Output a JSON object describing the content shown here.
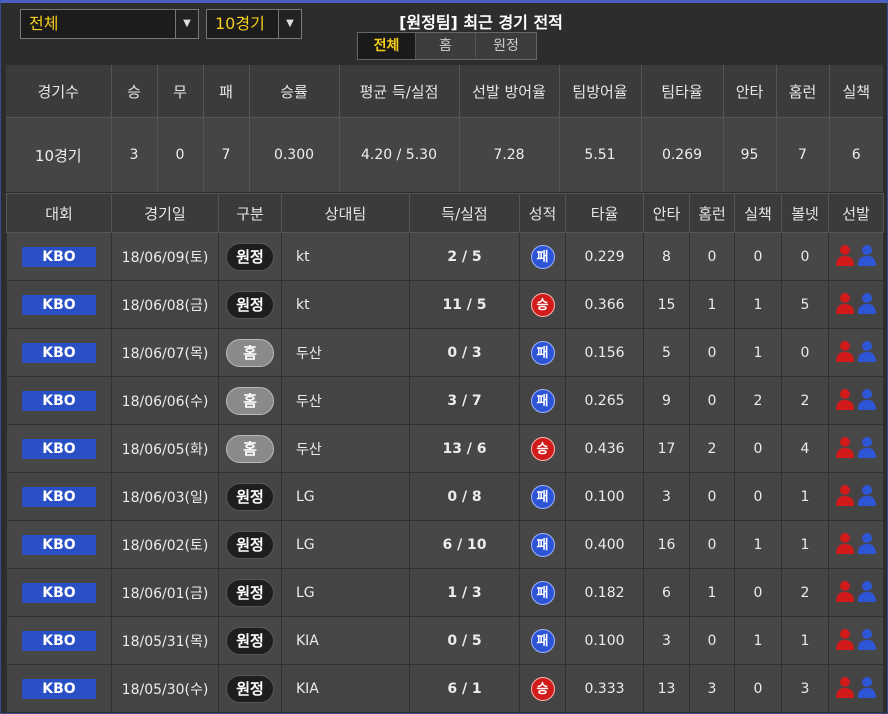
{
  "controls": {
    "filter_value": "전체",
    "games_value": "10경기",
    "title": "[원정팀] 최근 경기 전적",
    "tabs": [
      {
        "label": "전체",
        "active": true
      },
      {
        "label": "홈",
        "active": false
      },
      {
        "label": "원정",
        "active": false
      }
    ]
  },
  "summary": {
    "headers": [
      "경기수",
      "승",
      "무",
      "패",
      "승률",
      "평균 득/실점",
      "선발 방어율",
      "팀방어율",
      "팀타율",
      "안타",
      "홈런",
      "실책"
    ],
    "values": [
      "10경기",
      "3",
      "0",
      "7",
      "0.300",
      "4.20 / 5.30",
      "7.28",
      "5.51",
      "0.269",
      "95",
      "7",
      "6"
    ]
  },
  "games": {
    "headers": [
      "대회",
      "경기일",
      "구분",
      "상대팀",
      "득/실점",
      "성적",
      "타율",
      "안타",
      "홈런",
      "실책",
      "볼넷",
      "선발"
    ],
    "rows": [
      {
        "league": "KBO",
        "date": "18/06/09(토)",
        "side": "원정",
        "opp": "kt",
        "score": "2 / 5",
        "result": "패",
        "avg": "0.229",
        "hits": "8",
        "hr": "0",
        "err": "0",
        "bb": "0"
      },
      {
        "league": "KBO",
        "date": "18/06/08(금)",
        "side": "원정",
        "opp": "kt",
        "score": "11 / 5",
        "result": "승",
        "avg": "0.366",
        "hits": "15",
        "hr": "1",
        "err": "1",
        "bb": "5"
      },
      {
        "league": "KBO",
        "date": "18/06/07(목)",
        "side": "홈",
        "opp": "두산",
        "score": "0 / 3",
        "result": "패",
        "avg": "0.156",
        "hits": "5",
        "hr": "0",
        "err": "1",
        "bb": "0"
      },
      {
        "league": "KBO",
        "date": "18/06/06(수)",
        "side": "홈",
        "opp": "두산",
        "score": "3 / 7",
        "result": "패",
        "avg": "0.265",
        "hits": "9",
        "hr": "0",
        "err": "2",
        "bb": "2"
      },
      {
        "league": "KBO",
        "date": "18/06/05(화)",
        "side": "홈",
        "opp": "두산",
        "score": "13 / 6",
        "result": "승",
        "avg": "0.436",
        "hits": "17",
        "hr": "2",
        "err": "0",
        "bb": "4"
      },
      {
        "league": "KBO",
        "date": "18/06/03(일)",
        "side": "원정",
        "opp": "LG",
        "score": "0 / 8",
        "result": "패",
        "avg": "0.100",
        "hits": "3",
        "hr": "0",
        "err": "0",
        "bb": "1"
      },
      {
        "league": "KBO",
        "date": "18/06/02(토)",
        "side": "원정",
        "opp": "LG",
        "score": "6 / 10",
        "result": "패",
        "avg": "0.400",
        "hits": "16",
        "hr": "0",
        "err": "1",
        "bb": "1"
      },
      {
        "league": "KBO",
        "date": "18/06/01(금)",
        "side": "원정",
        "opp": "LG",
        "score": "1 / 3",
        "result": "패",
        "avg": "0.182",
        "hits": "6",
        "hr": "1",
        "err": "0",
        "bb": "2"
      },
      {
        "league": "KBO",
        "date": "18/05/31(목)",
        "side": "원정",
        "opp": "KIA",
        "score": "0 / 5",
        "result": "패",
        "avg": "0.100",
        "hits": "3",
        "hr": "0",
        "err": "1",
        "bb": "1"
      },
      {
        "league": "KBO",
        "date": "18/05/30(수)",
        "side": "원정",
        "opp": "KIA",
        "score": "6 / 1",
        "result": "승",
        "avg": "0.333",
        "hits": "13",
        "hr": "3",
        "err": "0",
        "bb": "3"
      }
    ]
  },
  "icons": {
    "pitcher_home": "red-person-icon",
    "pitcher_away": "blue-person-icon"
  },
  "colors": {
    "accent": "#f3cd1b",
    "league_badge": "#2b4fc4",
    "win": "#d11b1b",
    "loss": "#2d55d6",
    "home_pitcher": "#d11b1b",
    "away_pitcher": "#2d55d6"
  }
}
